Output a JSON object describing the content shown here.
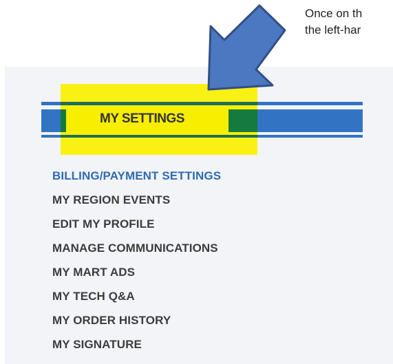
{
  "instruction": {
    "line1": "Once on th",
    "line2": "the left-har"
  },
  "settings_panel": {
    "title": "MY SETTINGS",
    "menu_items": [
      {
        "label": "BILLING/PAYMENT SETTINGS",
        "active": true
      },
      {
        "label": "MY REGION EVENTS",
        "active": false
      },
      {
        "label": "EDIT MY PROFILE",
        "active": false
      },
      {
        "label": "MANAGE COMMUNICATIONS",
        "active": false
      },
      {
        "label": "MY MART ADS",
        "active": false
      },
      {
        "label": "MY TECH Q&A",
        "active": false
      },
      {
        "label": "MY ORDER HISTORY",
        "active": false
      },
      {
        "label": "MY SIGNATURE",
        "active": false
      }
    ]
  },
  "colors": {
    "accent_blue": "#3273c2",
    "active_link": "#2f6bb3",
    "highlight_yellow": "#faf000",
    "arrow_fill": "#4b78c0",
    "arrow_stroke": "#2f4f86",
    "panel_bg": "#f2f4f7"
  },
  "annotation": {
    "arrow_icon": "arrow-down-left-icon"
  }
}
